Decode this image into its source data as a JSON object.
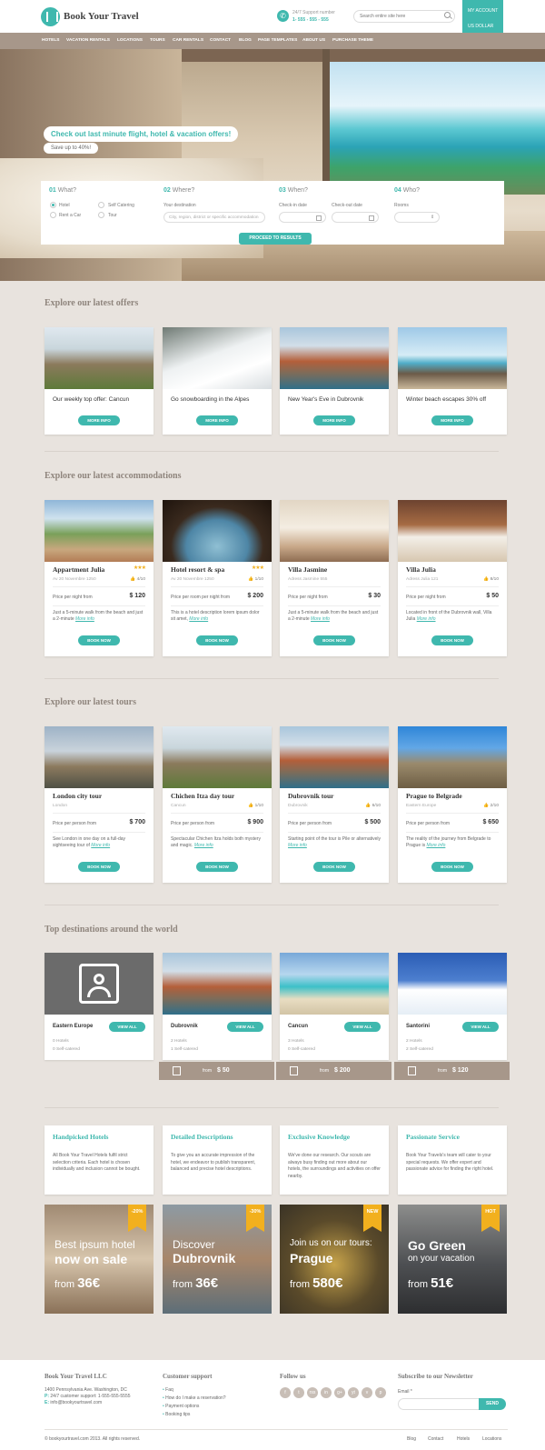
{
  "header": {
    "logo_text": "Book Your Travel",
    "support_label": "24/7 Support number",
    "support_phone": "1- 555 - 555 - 555",
    "search_placeholder": "Search entire site here",
    "my_account": "MY ACCOUNT",
    "currency": "US DOLLAR"
  },
  "nav": [
    "HOTELS",
    "VACATION RENTALS",
    "LOCATIONS",
    "TOURS",
    "CAR RENTALS",
    "CONTACT",
    "BLOG",
    "PAGE TEMPLATES",
    "ABOUT US",
    "PURCHASE THEME"
  ],
  "hero": {
    "promo_title": "Check out last minute flight, hotel & vacation offers!",
    "promo_sub": "Save up to 40%!",
    "what_num": "01",
    "what_label": "What?",
    "where_num": "02",
    "where_label": "Where?",
    "when_num": "03",
    "when_label": "When?",
    "who_num": "04",
    "who_label": "Who?",
    "options": [
      "Hotel",
      "Self Catering",
      "Rent a Car",
      "Tour"
    ],
    "destination_label": "Your destination",
    "destination_placeholder": "City, region, district or specific accommodation",
    "checkin_label": "Check-in date",
    "checkout_label": "Check-out date",
    "rooms_label": "Rooms",
    "proceed": "PROCEED TO RESULTS"
  },
  "offers": {
    "title": "Explore our latest offers",
    "items": [
      {
        "title": "Our weekly top offer: Cancun",
        "button": "MORE INFO"
      },
      {
        "title": "Go snowboarding in the Alpes",
        "button": "MORE INFO"
      },
      {
        "title": "New Year's Eve in Dubrovnik",
        "button": "MORE INFO"
      },
      {
        "title": "Winter beach escapes 30% off",
        "button": "MORE INFO"
      }
    ]
  },
  "accommodations": {
    "title": "Explore our latest accommodations",
    "items": [
      {
        "name": "Appartment Julia",
        "stars": "★★★",
        "address": "Av 20 Novembre 1250",
        "rating": "4/10",
        "price_label": "Price per night from",
        "price": "$ 120",
        "desc": "Just a 5-minute walk from the beach and just a 2-minute",
        "more": "More info",
        "button": "BOOK NOW"
      },
      {
        "name": "Hotel resort & spa",
        "stars": "★★★",
        "address": "Av 20 Novembre 1250",
        "rating": "1/10",
        "price_label": "Price per room per night from",
        "price": "$ 200",
        "desc": "This is a hotel description lorem ipsum dolor sit amet,",
        "more": "More info",
        "button": "BOOK NOW"
      },
      {
        "name": "Villa Jasmine",
        "stars": "",
        "address": "Adress Jasmine 555",
        "rating": "",
        "price_label": "Price per night from",
        "price": "$ 30",
        "desc": "Just a 5-minute walk from the beach and just a 2-minute",
        "more": "More info",
        "button": "BOOK NOW"
      },
      {
        "name": "Villa Julia",
        "stars": "",
        "address": "Adress Julia 121",
        "rating": "8/10",
        "price_label": "Price per night from",
        "price": "$ 50",
        "desc": "Located in front of the Dubrovnik wall, Villa Julia",
        "more": "More info",
        "button": "BOOK NOW"
      }
    ]
  },
  "tours": {
    "title": "Explore our latest tours",
    "items": [
      {
        "name": "London city tour",
        "location": "London",
        "rating": "",
        "price_label": "Price per person from",
        "price": "$ 700",
        "desc": "See London in one day on a full-day sightseeing tour of",
        "more": "More info",
        "button": "BOOK NOW"
      },
      {
        "name": "Chichen Itza day tour",
        "location": "Cancun",
        "rating": "1/10",
        "price_label": "Price per person from",
        "price": "$ 900",
        "desc": "Spectacular Chichen Itza holds both mystery and magic.",
        "more": "More info",
        "button": "BOOK NOW"
      },
      {
        "name": "Dubrovnik tour",
        "location": "Dubrovnik",
        "rating": "6/10",
        "price_label": "Price per person from",
        "price": "$ 500",
        "desc": "Starting point of the tour is Pile or alternatively",
        "more": "More info",
        "button": "BOOK NOW"
      },
      {
        "name": "Prague to Belgrade",
        "location": "Eastern Europe",
        "rating": "2/10",
        "price_label": "Price per person from",
        "price": "$ 650",
        "desc": "The reality of the journey from Belgrade to Prague is",
        "more": "More info",
        "button": "BOOK NOW"
      }
    ]
  },
  "destinations": {
    "title": "Top destinations around the world",
    "items": [
      {
        "name": "Eastern Europe",
        "hotels": "0 Hotels",
        "self": "0 Self-catered",
        "button": "VIEW ALL",
        "from": "",
        "price": ""
      },
      {
        "name": "Dubrovnik",
        "hotels": "2 Hotels",
        "self": "1 Self-catered",
        "button": "VIEW ALL",
        "from": "from",
        "price": "$ 50"
      },
      {
        "name": "Cancun",
        "hotels": "3 Hotels",
        "self": "0 Self-catered",
        "button": "VIEW ALL",
        "from": "from",
        "price": "$ 200"
      },
      {
        "name": "Santorini",
        "hotels": "2 Hotels",
        "self": "2 Self-catered",
        "button": "VIEW ALL",
        "from": "from",
        "price": "$ 120"
      }
    ]
  },
  "features": [
    {
      "title": "Handpicked Hotels",
      "text": "All Book Your Travel Hotels fulfil strict selection criteria. Each hotel is chosen individually and inclusion cannot be bought."
    },
    {
      "title": "Detailed Descriptions",
      "text": "To give you an accurate impression of the hotel, we endeavor to publish transparent, balanced and precise hotel descriptions."
    },
    {
      "title": "Exclusive Knowledge",
      "text": "We've done our research. Our scouts are always busy finding out more about our hotels, the surroundings and activities on offer nearby."
    },
    {
      "title": "Passionate Service",
      "text": "Book Your Travels's team will cater to your special requests. We offer expert and passionate advice for finding the right hotel."
    }
  ],
  "deals": [
    {
      "badge": "-20%",
      "line1": "Best ipsum hotel",
      "line2": "now on sale",
      "from": "from",
      "price": "36€"
    },
    {
      "badge": "-30%",
      "line1": "Discover",
      "line2": "Dubrovnik",
      "from": "from",
      "price": "36€"
    },
    {
      "badge": "NEW",
      "line1": "Join us on our tours:",
      "line2": "Prague",
      "from": "from",
      "price": "580€"
    },
    {
      "badge": "HOT",
      "line1": "Go Green",
      "line2": "on your vacation",
      "from": "from",
      "price": "51€"
    }
  ],
  "footer": {
    "company_title": "Book Your Travel LLC",
    "address": "1400 Pennsylvania Ave. Washington, DC",
    "phone_prefix": "P:",
    "phone": "24/7 customer support: 1-555-555-5555",
    "email_prefix": "E:",
    "email": "info@bookyourtravel.com",
    "support_title": "Customer support",
    "support_links": [
      "Faq",
      "How do I make a reservation?",
      "Payment options",
      "Booking tips"
    ],
    "follow_title": "Follow us",
    "social": [
      "f",
      "t",
      "rss",
      "in",
      "g+",
      "yt",
      "v",
      "p"
    ],
    "newsletter_title": "Subscribe to our Newsletter",
    "email_label": "Email *",
    "send": "SEND",
    "copyright": "© bookyourtravel.com 2013. All rights reserved.",
    "bottom_links": [
      "Blog",
      "Contact",
      "Hotels",
      "Locations"
    ]
  },
  "colors": {
    "accent": "#3fb8ae",
    "nav": "#a7978a",
    "background": "#e8e3de",
    "star": "#f2b01e"
  }
}
